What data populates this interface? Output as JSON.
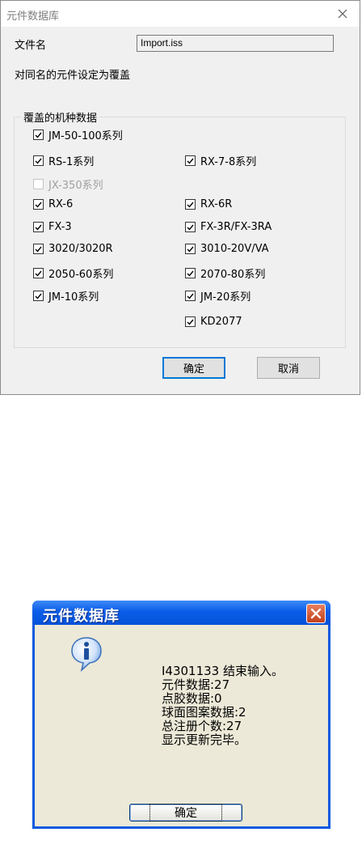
{
  "dialog1": {
    "title": "元件数据库",
    "file_label": "文件名",
    "file_value": "Import.iss",
    "overwrite_label": "对同名的元件设定为覆盖",
    "group_title": "覆盖的机种数据",
    "checkboxes": [
      {
        "label": "JM-50-100系列",
        "checked": true,
        "enabled": true
      },
      {
        "label": "RS-1系列",
        "checked": true,
        "enabled": true
      },
      {
        "label": "RX-7-8系列",
        "checked": true,
        "enabled": true
      },
      {
        "label": "JX-350系列",
        "checked": false,
        "enabled": false
      },
      {
        "label": "RX-6",
        "checked": true,
        "enabled": true
      },
      {
        "label": "RX-6R",
        "checked": true,
        "enabled": true
      },
      {
        "label": "FX-3",
        "checked": true,
        "enabled": true
      },
      {
        "label": "FX-3R/FX-3RA",
        "checked": true,
        "enabled": true
      },
      {
        "label": "3020/3020R",
        "checked": true,
        "enabled": true
      },
      {
        "label": "3010-20V/VA",
        "checked": true,
        "enabled": true
      },
      {
        "label": "2050-60系列",
        "checked": true,
        "enabled": true
      },
      {
        "label": "2070-80系列",
        "checked": true,
        "enabled": true
      },
      {
        "label": "JM-10系列",
        "checked": true,
        "enabled": true
      },
      {
        "label": "JM-20系列",
        "checked": true,
        "enabled": true
      },
      {
        "label": "KD2077",
        "checked": true,
        "enabled": true
      }
    ],
    "ok_label": "确定",
    "cancel_label": "取消"
  },
  "dialog2": {
    "title": "元件数据库",
    "icon": "info-icon",
    "message_lines": [
      "I4301133 结束输入。",
      "元件数据:27",
      "点胶数据:0",
      "球面图案数据:2",
      "总注册个数:27",
      "显示更新完毕。"
    ],
    "ok_label": "确定"
  },
  "colors": {
    "xp_title_blue": "#0a5ce8",
    "xp_close_red": "#c2411b",
    "win10_focus_blue": "#0078d7"
  }
}
